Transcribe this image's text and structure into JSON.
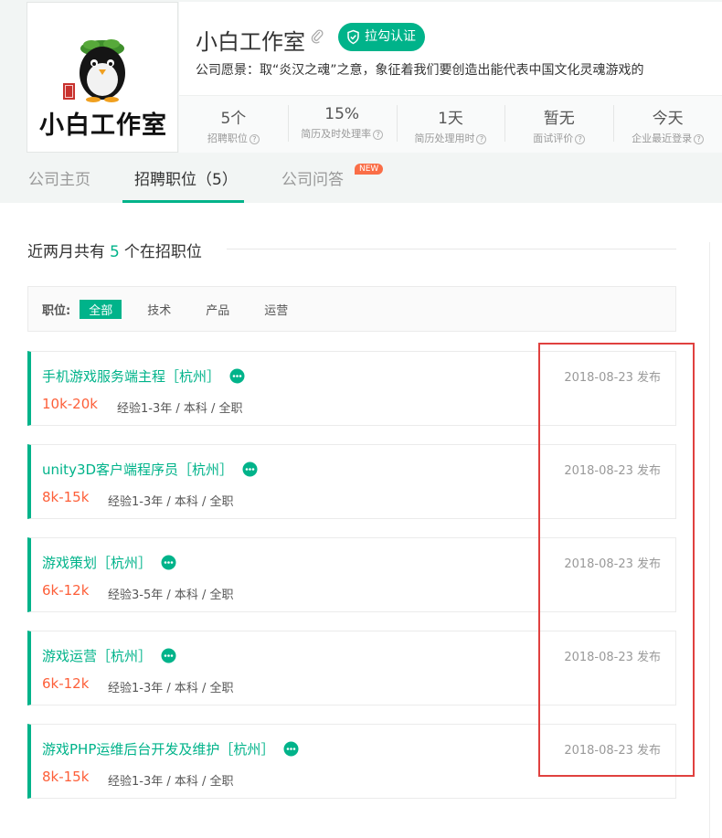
{
  "company": {
    "logo_text": "小白工作室",
    "name": "小白工作室",
    "certification": "拉勾认证",
    "vision": "公司愿景：取“炎汉之魂”之意，象征着我们要创造出能代表中国文化灵魂游戏的"
  },
  "stats": [
    {
      "value": "5个",
      "label": "招聘职位"
    },
    {
      "value": "15%",
      "label": "简历及时处理率"
    },
    {
      "value": "1天",
      "label": "简历处理用时"
    },
    {
      "value": "暂无",
      "label": "面试评价"
    },
    {
      "value": "今天",
      "label": "企业最近登录"
    }
  ],
  "tabs": {
    "home": "公司主页",
    "jobs": "招聘职位（5）",
    "qa": "公司问答",
    "qa_badge": "NEW"
  },
  "summary": {
    "prefix": "近两月共有",
    "count": "5",
    "suffix": "个在招职位"
  },
  "filter": {
    "label": "职位:",
    "options": [
      "全部",
      "技术",
      "产品",
      "运营"
    ]
  },
  "jobs": [
    {
      "title": "手机游戏服务端主程［杭州］",
      "salary": "10k-20k",
      "requirements": "经验1-3年 / 本科 / 全职",
      "date": "2018-08-23 发布"
    },
    {
      "title": "unity3D客户端程序员［杭州］",
      "salary": "8k-15k",
      "requirements": "经验1-3年 / 本科 / 全职",
      "date": "2018-08-23 发布"
    },
    {
      "title": "游戏策划［杭州］",
      "salary": "6k-12k",
      "requirements": "经验3-5年 / 本科 / 全职",
      "date": "2018-08-23 发布"
    },
    {
      "title": "游戏运营［杭州］",
      "salary": "6k-12k",
      "requirements": "经验1-3年 / 本科 / 全职",
      "date": "2018-08-23 发布"
    },
    {
      "title": "游戏PHP运维后台开发及维护［杭州］",
      "salary": "8k-15k",
      "requirements": "经验1-3年 / 本科 / 全职",
      "date": "2018-08-23 发布"
    }
  ],
  "colors": {
    "accent": "#00b38a",
    "salary": "#fd5f39",
    "new_badge": "#fa6e47",
    "annotation": "#e0413f"
  }
}
